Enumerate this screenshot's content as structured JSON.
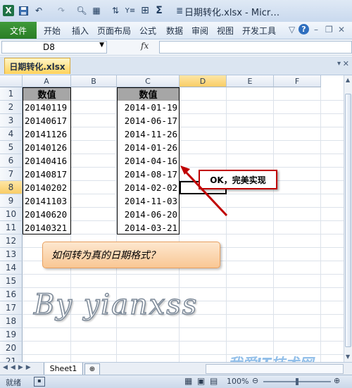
{
  "title": {
    "text": "日期转化.xlsx - Micr…"
  },
  "quick_access": {
    "excel_icon": "X",
    "save_icon": "floppy-icon",
    "undo_icon": "undo-icon",
    "redo_icon": "redo-icon",
    "sigma": "Σ"
  },
  "ribbon": {
    "file": "文件",
    "tabs": [
      "开始",
      "插入",
      "页面布局",
      "公式",
      "数据",
      "审阅",
      "视图",
      "开发工具"
    ]
  },
  "formula_bar": {
    "name_box": "D8",
    "fx": "fx",
    "value": ""
  },
  "workbook_tab": "日期转化.xlsx",
  "columns": [
    "A",
    "B",
    "C",
    "D",
    "E",
    "F"
  ],
  "rows": [
    "1",
    "2",
    "3",
    "4",
    "5",
    "6",
    "7",
    "8",
    "9",
    "10",
    "11",
    "12",
    "13",
    "14",
    "15",
    "16",
    "17",
    "18",
    "19",
    "20",
    "21"
  ],
  "table_a": {
    "header": "数值",
    "values": [
      "20140119",
      "20140617",
      "20141126",
      "20140126",
      "20140416",
      "20140817",
      "20140202",
      "20141103",
      "20140620",
      "20140321"
    ]
  },
  "table_c": {
    "header": "数值",
    "values": [
      "2014-01-19",
      "2014-06-17",
      "2014-11-26",
      "2014-01-26",
      "2014-04-16",
      "2014-08-17",
      "2014-02-02",
      "2014-11-03",
      "2014-06-20",
      "2014-03-21"
    ]
  },
  "callout": "OK，完美实现",
  "question": "如何转为真的日期格式？",
  "watermark": "By yianxss",
  "site_watermark": "我爱IT技术网",
  "sheet_tab": "Sheet1",
  "status": {
    "ready": "就绪",
    "zoom": "100%"
  },
  "colors": {
    "accent_red": "#c00000",
    "header_fill": "#a6a6a6",
    "file_tab": "#2a7d26"
  }
}
